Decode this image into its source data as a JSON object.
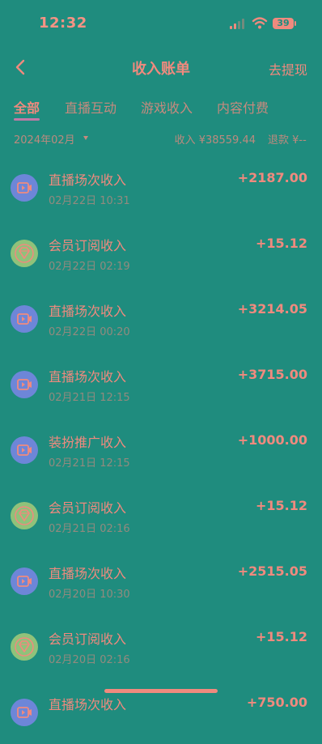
{
  "status_bar": {
    "time": "12:32",
    "battery": "39"
  },
  "header": {
    "title": "收入账单",
    "withdraw_label": "去提现"
  },
  "tabs": [
    {
      "label": "全部",
      "active": true
    },
    {
      "label": "直播互动",
      "active": false
    },
    {
      "label": "游戏收入",
      "active": false
    },
    {
      "label": "内容付费",
      "active": false
    }
  ],
  "summary": {
    "month": "2024年02月",
    "income": "收入 ¥38559.44",
    "refund": "退款 ¥--"
  },
  "records": [
    {
      "title": "直播场次收入",
      "time": "02月22日 10:31",
      "amount": "+2187.00",
      "icon": "video-icon"
    },
    {
      "title": "会员订阅收入",
      "time": "02月22日 02:19",
      "amount": "+15.12",
      "icon": "diamond-icon"
    },
    {
      "title": "直播场次收入",
      "time": "02月22日 00:20",
      "amount": "+3214.05",
      "icon": "video-icon"
    },
    {
      "title": "直播场次收入",
      "time": "02月21日 12:15",
      "amount": "+3715.00",
      "icon": "video-icon"
    },
    {
      "title": "装扮推广收入",
      "time": "02月21日 12:15",
      "amount": "+1000.00",
      "icon": "video-icon"
    },
    {
      "title": "会员订阅收入",
      "time": "02月21日 02:16",
      "amount": "+15.12",
      "icon": "diamond-icon"
    },
    {
      "title": "直播场次收入",
      "time": "02月20日 10:30",
      "amount": "+2515.05",
      "icon": "video-icon"
    },
    {
      "title": "会员订阅收入",
      "time": "02月20日 02:16",
      "amount": "+15.12",
      "icon": "diamond-icon"
    },
    {
      "title": "直播场次收入",
      "time": "",
      "amount": "+750.00",
      "icon": "video-icon"
    }
  ],
  "colors": {
    "background": "#1f8c7e",
    "text": "#f08a7e",
    "video_avatar": "#6d86d8",
    "vip_avatar": "#8fc27a",
    "tab_underline": "#c07aa6"
  }
}
